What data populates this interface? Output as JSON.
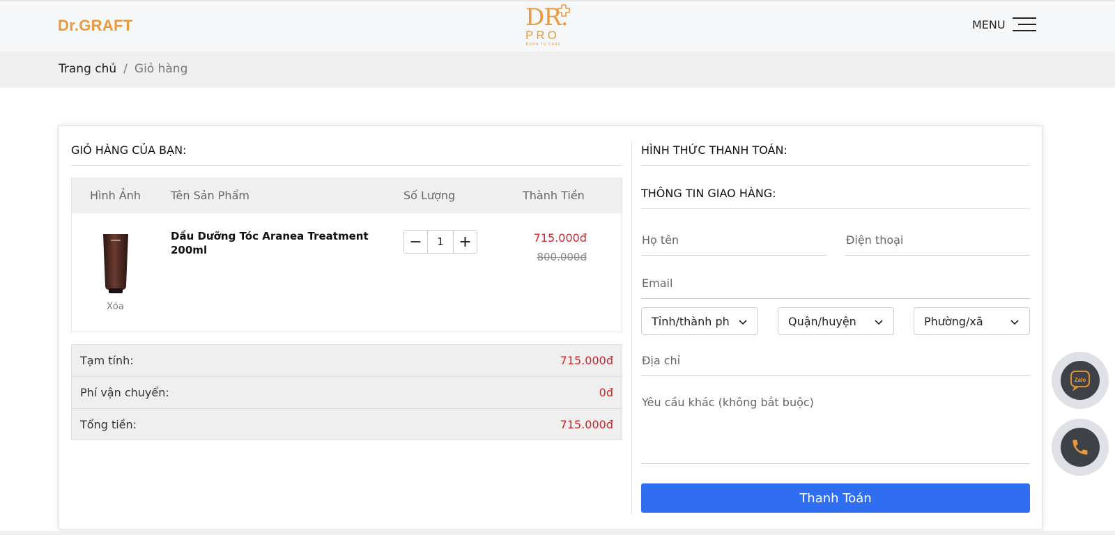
{
  "header": {
    "brand": "Dr.GRAFT",
    "logo": {
      "mark": "DR.",
      "sub": "PRO",
      "tagline": "BORN TO CARE"
    },
    "menu_label": "MENU"
  },
  "breadcrumb": {
    "home": "Trang chủ",
    "separator": "/",
    "current": "Giỏ hàng"
  },
  "cart": {
    "title": "GIỎ HÀNG CỦA BẠN:",
    "columns": [
      "Hình Ảnh",
      "Tên Sản Phẩm",
      "Số Lượng",
      "Thành Tiền"
    ],
    "items": [
      {
        "name": "Dầu Dưỡng Tóc Aranea Treatment 200ml",
        "remove_label": "Xóa",
        "quantity": "1",
        "price": "715.000đ",
        "old_price": "800.000đ"
      }
    ],
    "qty_minus": "−",
    "qty_plus": "+"
  },
  "totals": [
    {
      "label": "Tạm tính:",
      "value": "715.000đ"
    },
    {
      "label": "Phí vận chuyển:",
      "value": "0đ"
    },
    {
      "label": "Tổng tiền:",
      "value": "715.000đ"
    }
  ],
  "checkout": {
    "payment_title": "HÌNH THỨC THANH TOÁN:",
    "shipping_title": "THÔNG TIN GIAO HÀNG:",
    "fields": {
      "name": "Họ tên",
      "phone": "Điện thoại",
      "email": "Email",
      "address": "Địa chỉ",
      "note": "Yêu cầu khác (không bắt buộc)"
    },
    "selects": {
      "province": "Tỉnh/thành ph",
      "district": "Quận/huyện",
      "ward": "Phường/xã"
    },
    "submit_label": "Thanh Toán"
  },
  "floating": {
    "zalo_label": "Zalo"
  },
  "colors": {
    "brand": "#e89a3c",
    "price": "#d0232a",
    "primary_button": "#2f6ef0"
  }
}
